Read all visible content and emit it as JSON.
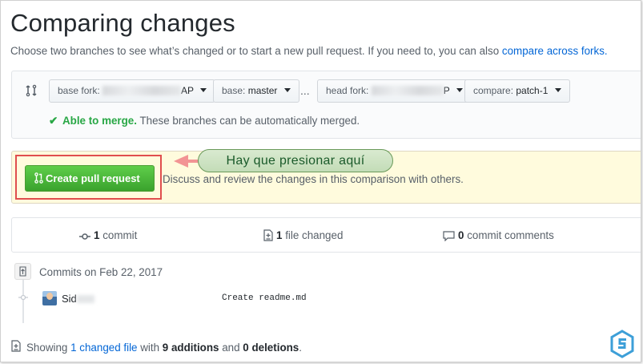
{
  "header": {
    "title": "Comparing changes",
    "subtitle": "Choose two branches to see what’s changed or to start a new pull request. If you need to, you can also",
    "subtitle_link": "compare across forks."
  },
  "range": {
    "base_fork_label": "base fork:",
    "base_fork_suffix": "AP",
    "base_label": "base:",
    "base_value": "master",
    "dots": "...",
    "head_fork_label": "head fork:",
    "head_fork_suffix": "P",
    "compare_label": "compare:",
    "compare_value": "patch-1",
    "merge_status": "Able to merge.",
    "merge_detail": "These branches can be automatically merged."
  },
  "pull_request": {
    "button_label": "Create pull request",
    "description": "Discuss and review the changes in this comparison with others.",
    "annotation": "Hay que presionar aquí"
  },
  "stats": {
    "commits_count": "1",
    "commits_label": "commit",
    "files_count": "1",
    "files_label": "file changed",
    "comments_count": "0",
    "comments_label": "commit comments"
  },
  "commits": {
    "date_heading": "Commits on Feb 22, 2017",
    "items": [
      {
        "author": "Sid",
        "message": "Create readme.md"
      }
    ]
  },
  "summary": {
    "prefix": "Showing",
    "link": "1 changed file",
    "with": "with",
    "additions": "9 additions",
    "and": "and",
    "deletions": "0 deletions",
    "period": "."
  },
  "colors": {
    "green_button": "#3aa22d",
    "link": "#0366d6",
    "highlight_frame": "#e04e4e",
    "callout_bg": "#c3dcb7"
  }
}
